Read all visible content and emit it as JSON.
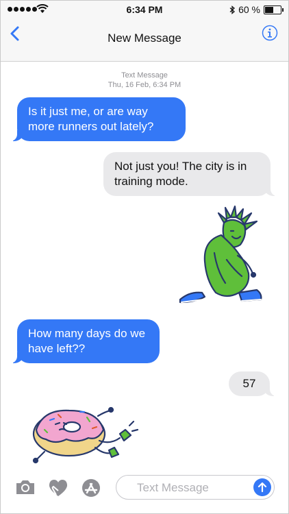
{
  "status_bar": {
    "time": "6:34 PM",
    "battery": "60 %",
    "battery_level": 0.6
  },
  "nav": {
    "title": "New Message",
    "back_icon": "chevron-left-icon",
    "info_icon": "info-icon"
  },
  "thread": {
    "timestamp_label": "Text Message",
    "timestamp_date": "Thu, 16 Feb, 6:34 PM",
    "messages": [
      {
        "from": "me",
        "text": "Is it just me, or are way more runners out lately?"
      },
      {
        "from": "them",
        "text": "Not just you! The city is in training mode."
      },
      {
        "from": "them",
        "sticker": "statue-of-liberty-runner-sticker"
      },
      {
        "from": "me",
        "text": "How many days do we have left??"
      },
      {
        "from": "them",
        "text": "57"
      },
      {
        "from": "me",
        "sticker": "running-donut-sticker"
      }
    ]
  },
  "composer": {
    "placeholder": "Text Message",
    "value": ""
  },
  "colors": {
    "accent": "#3478f6",
    "received_bubble": "#e9e9eb",
    "liberty_green": "#5fbf3a",
    "donut_pink": "#f2a6cf"
  }
}
